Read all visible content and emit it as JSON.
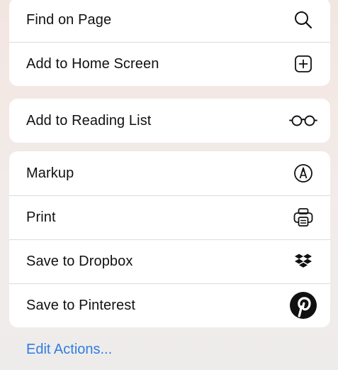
{
  "group1": {
    "items": [
      {
        "label": "Find on Page",
        "icon": "search-icon"
      },
      {
        "label": "Add to Home Screen",
        "icon": "add-square-icon"
      }
    ]
  },
  "group2": {
    "items": [
      {
        "label": "Add to Reading List",
        "icon": "glasses-icon"
      }
    ]
  },
  "group3": {
    "items": [
      {
        "label": "Markup",
        "icon": "markup-pen-icon"
      },
      {
        "label": "Print",
        "icon": "printer-icon"
      },
      {
        "label": "Save to Dropbox",
        "icon": "dropbox-icon"
      },
      {
        "label": "Save to Pinterest",
        "icon": "pinterest-icon"
      }
    ]
  },
  "footer": {
    "edit_actions_label": "Edit Actions..."
  },
  "colors": {
    "link": "#2f7de1",
    "text": "#111111",
    "separator": "#dcdcde"
  }
}
